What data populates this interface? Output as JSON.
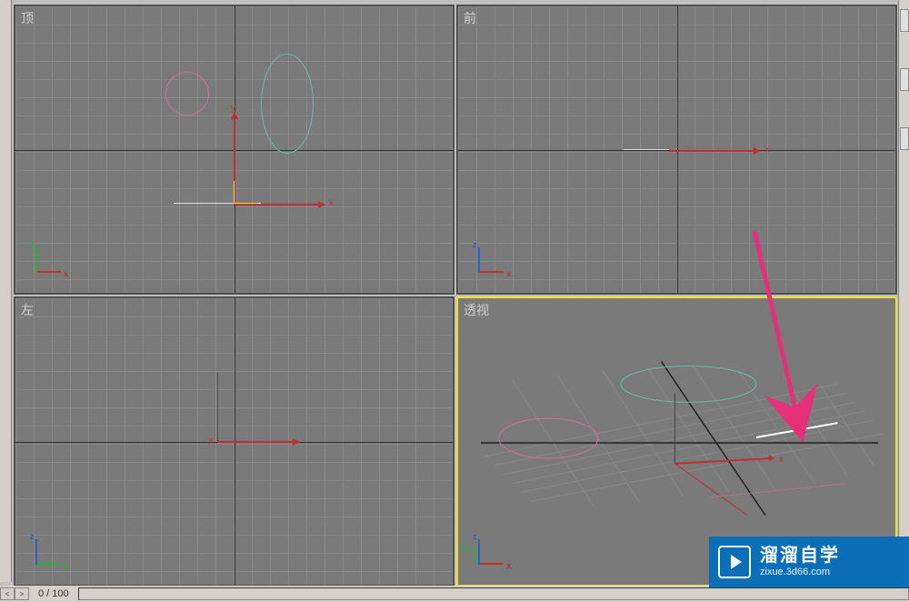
{
  "viewports": {
    "top": {
      "label": "顶"
    },
    "front": {
      "label": "前"
    },
    "left": {
      "label": "左"
    },
    "perspective": {
      "label": "透视"
    }
  },
  "axis_labels": {
    "x": "x",
    "y": "y",
    "z": "z"
  },
  "timeline": {
    "frame_display": "0  /  100",
    "prev_arrow": "<",
    "next_arrow": ">"
  },
  "watermark": {
    "title": "溜溜自学",
    "url": "zixue.3d66.com"
  }
}
